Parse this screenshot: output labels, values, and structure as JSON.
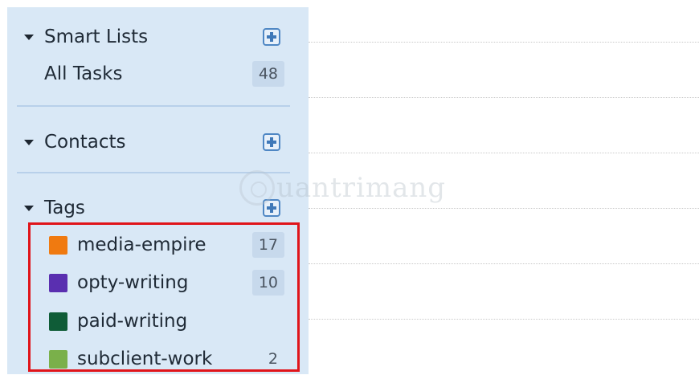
{
  "smart_lists": {
    "title": "Smart Lists",
    "items": [
      {
        "label": "All Tasks",
        "count": "48"
      }
    ]
  },
  "contacts": {
    "title": "Contacts"
  },
  "tags": {
    "title": "Tags",
    "items": [
      {
        "label": "media-empire",
        "count": "17",
        "color": "#f07a10"
      },
      {
        "label": "opty-writing",
        "count": "10",
        "color": "#5a2fb0"
      },
      {
        "label": "paid-writing",
        "count": "",
        "color": "#0f5c37"
      },
      {
        "label": "subclient-work",
        "count": "2",
        "color": "#7ab04a"
      }
    ]
  },
  "icons": {
    "add": "plus-square-icon",
    "collapse": "caret-down-icon"
  },
  "colors": {
    "sidebar_bg": "#d9e8f6",
    "highlight_border": "#e0141a",
    "accent": "#4f87c4"
  },
  "watermark": {
    "text": "uantrimang"
  }
}
